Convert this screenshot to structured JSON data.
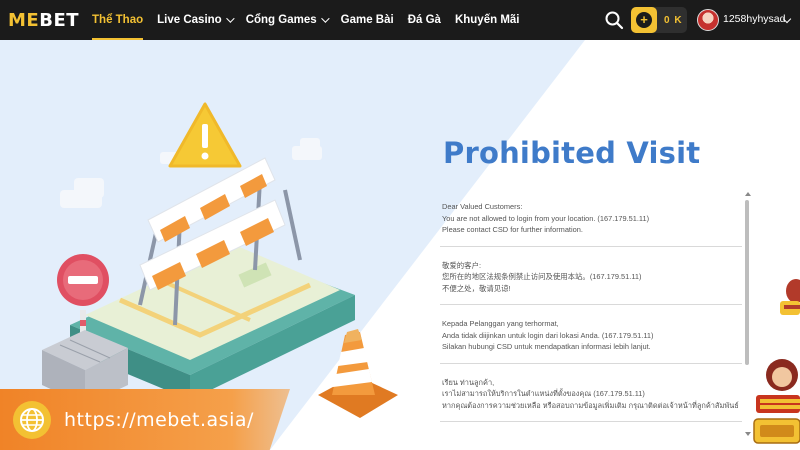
{
  "nav": {
    "logo": {
      "part1": "ME",
      "part2": "BET"
    },
    "menu": [
      {
        "label": "Thể Thao",
        "active": true,
        "dropdown": false
      },
      {
        "label": "Live Casino",
        "active": false,
        "dropdown": true
      },
      {
        "label": "Cổng Games",
        "active": false,
        "dropdown": true
      },
      {
        "label": "Game Bài",
        "active": false,
        "dropdown": false
      },
      {
        "label": "Đá Gà",
        "active": false,
        "dropdown": false
      },
      {
        "label": "Khuyến Mãi",
        "active": false,
        "dropdown": false
      }
    ],
    "search_icon": "search-icon",
    "balance": "0 K",
    "username": "1258hyhysad"
  },
  "page": {
    "title": "Prohibited Visit"
  },
  "messages": [
    {
      "lines": [
        "Dear Valued Customers:",
        "You are not allowed to login from your location. (167.179.51.11)",
        "Please contact CSD for further information."
      ]
    },
    {
      "lines": [
        "敬爱的客户:",
        "您所在的地区法规条例禁止访问及使用本站。(167.179.51.11)",
        "不便之处，敬请见谅!"
      ]
    },
    {
      "lines": [
        "Kepada Pelanggan yang terhormat,",
        "Anda tidak diijinkan untuk login dari lokasi Anda. (167.179.51.11)",
        "Silakan hubungi CSD untuk mendapatkan informasi lebih lanjut."
      ]
    },
    {
      "lines": [
        "เรียน ท่านลูกค้า,",
        "เราไม่สามารถให้บริการในตำแหน่งที่ตั้งของคุณ (167.179.51.11)",
        "หากคุณต้องการความช่วยเหลือ หรือสอบถามข้อมูลเพิ่มเติม กรุณาติดต่อเจ้าหน้าที่ลูกค้าสัมพันธ์"
      ]
    }
  ],
  "banner": {
    "url": "https://mebet.asia/"
  },
  "colors": {
    "brand_yellow": "#f3c133",
    "title_blue": "#3f7bc9",
    "nav_bg": "#1b1b1b",
    "banner_orange": "#f08327"
  }
}
